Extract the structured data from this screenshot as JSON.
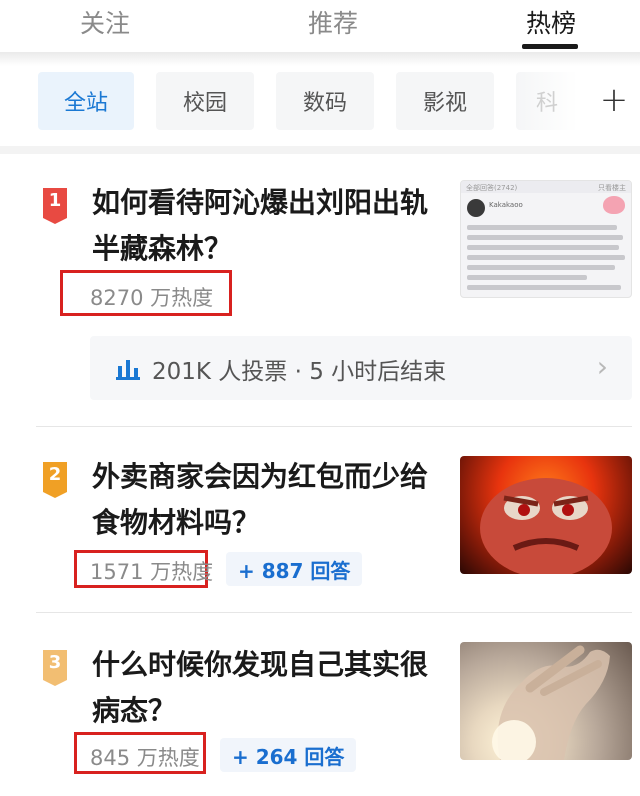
{
  "tabs": [
    {
      "label": "关注",
      "active": false
    },
    {
      "label": "推荐",
      "active": false
    },
    {
      "label": "热榜",
      "active": true
    }
  ],
  "categories": {
    "items": [
      {
        "label": "全站",
        "active": true
      },
      {
        "label": "校园",
        "active": false
      },
      {
        "label": "数码",
        "active": false
      },
      {
        "label": "影视",
        "active": false
      },
      {
        "label": "科",
        "active": false
      }
    ],
    "add_icon": "plus-icon"
  },
  "hot_list": [
    {
      "rank": "1",
      "rank_color": "#e84a42",
      "title": "如何看待阿沁爆出刘阳出轨半藏森林？",
      "heat": "8270 万热度",
      "poll": {
        "text": "201K 人投票 · 5 小时后结束",
        "icon": "bar-chart-icon"
      },
      "thumbnail": {
        "kind": "screenshot",
        "header_left": "全部回答(2742)",
        "header_right": "只看楼主",
        "username": "Kakakaoo"
      }
    },
    {
      "rank": "2",
      "rank_color": "#f0a025",
      "title": "外卖商家会因为红包而少给食物材料吗？",
      "heat": "1571 万热度",
      "answers": "+ 887 回答",
      "thumbnail": {
        "kind": "angry-frog-image"
      }
    },
    {
      "rank": "3",
      "rank_color": "#f2be72",
      "title": "什么时候你发现自己其实很病态？",
      "heat": "845 万热度",
      "answers": "+ 264 回答",
      "thumbnail": {
        "kind": "hand-in-light-image"
      }
    }
  ],
  "colors": {
    "accent_blue": "#1a78d3",
    "highlight_red": "#d8211f"
  }
}
